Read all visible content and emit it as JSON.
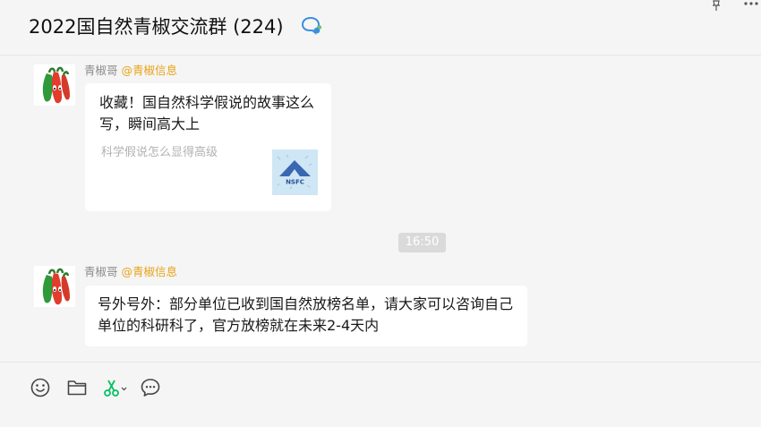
{
  "header": {
    "title": "2022国自然青椒交流群 (224)",
    "icons": [
      "chat-bubbles-icon",
      "pin-icon",
      "more-icon"
    ]
  },
  "messages": [
    {
      "sender": "青椒哥",
      "sender_tag": "@青椒信息",
      "type": "link-card",
      "card_title": "收藏！国自然科学假说的故事这么写，瞬间高大上",
      "card_desc": "科学假说怎么显得高级",
      "thumb_label": "NSFC"
    },
    {
      "type": "time",
      "text": "16:50"
    },
    {
      "sender": "青椒哥",
      "sender_tag": "@青椒信息",
      "type": "text",
      "text": "号外号外：部分单位已收到国自然放榜名单，请大家可以咨询自己单位的科研科了，官方放榜就在未来2-4天内"
    }
  ],
  "toolbar": {
    "icons": [
      "emoji-icon",
      "folder-icon",
      "scissors-icon",
      "chat-icon"
    ]
  },
  "colors": {
    "background": "#f5f5f5",
    "bubble": "#ffffff",
    "tag": "#e8a317",
    "accent_green": "#07c160"
  }
}
